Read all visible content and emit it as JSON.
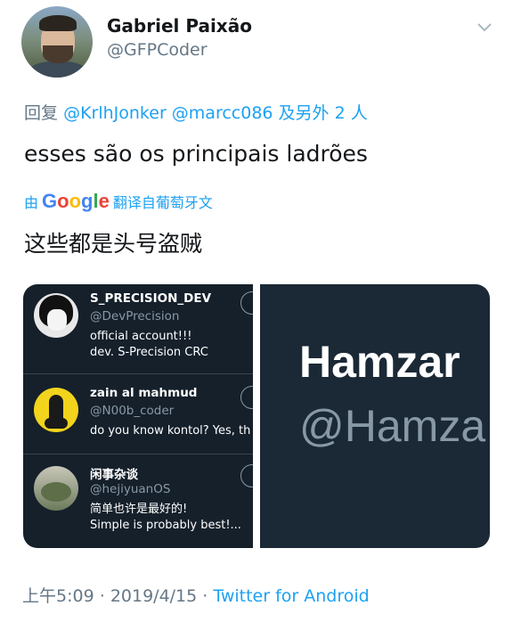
{
  "author": {
    "name": "Gabriel Paixão",
    "handle": "@GFPCoder"
  },
  "tweet": {
    "reply_prefix": "回复",
    "reply_mentions": "@KrlhJonker @marcc086",
    "reply_suffix": "及另外 2 人",
    "text": "esses são os principais ladrões",
    "translated_by_prefix": "由",
    "translated_by_suffix": "翻译自葡萄牙文",
    "translation": "这些都是头号盗贼"
  },
  "media": {
    "accounts": [
      {
        "name": "S_PRECISION_DEV",
        "handle": "@DevPrecision",
        "bio_line1": "official account!!!",
        "bio_line2": "dev. S-Precision CRC"
      },
      {
        "name": "zain al mahmud",
        "handle": "@N00b_coder",
        "bio_line1": "do you know kontol? Yes, th"
      },
      {
        "name": "闲事杂谈",
        "handle": "@hejiyuanOS",
        "bio_line1": "简单也许是最好的!",
        "bio_line2": "Simple is probably best!..."
      }
    ],
    "profile_zoom": {
      "name": "Hamzar",
      "handle": "@Hamza"
    }
  },
  "footer": {
    "time": "上午5:09",
    "date": "2019/4/15",
    "separator": "·",
    "source": "Twitter for Android"
  },
  "colors": {
    "link": "#1da1f2",
    "secondary_text": "#657786",
    "dark_bg": "#15202b"
  },
  "icons": {
    "menu": "chevron-down-icon",
    "follow": "follow-circle-icon"
  }
}
